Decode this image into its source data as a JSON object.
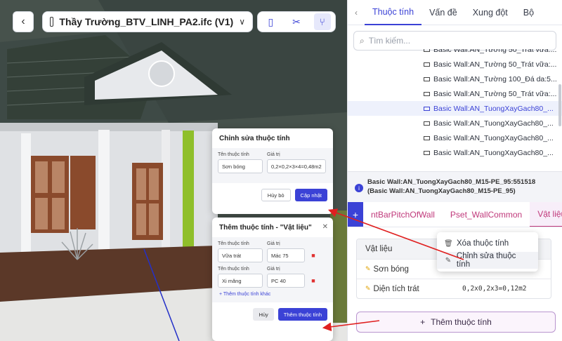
{
  "toolbar": {
    "file_name": "Thầy Trường_BTV_LINH_PA2.ifc (V1)",
    "back_icon": "chevron-left-icon",
    "tools": [
      "panel-icon",
      "scissors-icon",
      "tree-icon"
    ]
  },
  "edit_popup": {
    "title": "Chỉnh sửa thuộc tính",
    "name_label": "Tên thuộc tính",
    "value_label": "Giá trị",
    "name_value": "Sơn bóng",
    "value_value": "0,2×0,2×3×4=0,48m2",
    "cancel": "Hủy bỏ",
    "update": "Cập nhật"
  },
  "add_popup": {
    "title": "Thêm thuộc tính - \"Vật liệu\"",
    "rows": [
      {
        "name_label": "Tên thuộc tính",
        "value_label": "Giá trị",
        "name": "Vữa trát",
        "value": "Mác 75"
      },
      {
        "name_label": "Tên thuộc tính",
        "value_label": "Giá trị",
        "name": "Xi măng",
        "value": "PC 40"
      }
    ],
    "add_more": "+ Thêm thuộc tính khác",
    "cancel": "Hủy",
    "submit": "Thêm thuộc tính"
  },
  "panel": {
    "tabs": [
      "Thuộc tính",
      "Vấn đề",
      "Xung đột",
      "Bộ"
    ],
    "search_placeholder": "Tìm kiếm...",
    "tree_items": [
      "Basic Wall:AN_Tường 50_Trát vữa:...",
      "Basic Wall:AN_Tường 100_Đá da:5...",
      "Basic Wall:AN_Tường 50_Trát vữa:...",
      "Basic Wall:AN_TuongXayGach80_...",
      "Basic Wall:AN_TuongXayGach80_...",
      "Basic Wall:AN_TuongXayGach80_...",
      "Basic Wall:AN_TuongXayGach80_..."
    ],
    "selected_index": 3,
    "info": "Basic Wall:AN_TuongXayGach80_M15-PE_95:551518 (Basic Wall:AN_TuongXayGach80_M15-PE_95)",
    "psets": [
      "ntBarPitchOfWall",
      "Pset_WallCommon",
      "Vật liệu"
    ],
    "table_header": "Vật liệu",
    "table_rows": [
      {
        "key": "Sơn bóng",
        "value": ""
      },
      {
        "key": "Diện tích trát",
        "value": "0,2x0,2x3=0,12m2"
      }
    ],
    "context_menu": [
      "Xóa thuộc tính",
      "Chỉnh sửa thuộc tính"
    ],
    "add_button": "Thêm thuộc tính"
  },
  "colors": {
    "accent": "#3b42d6",
    "pset": "#c0397b",
    "arrow": "#e02020"
  }
}
